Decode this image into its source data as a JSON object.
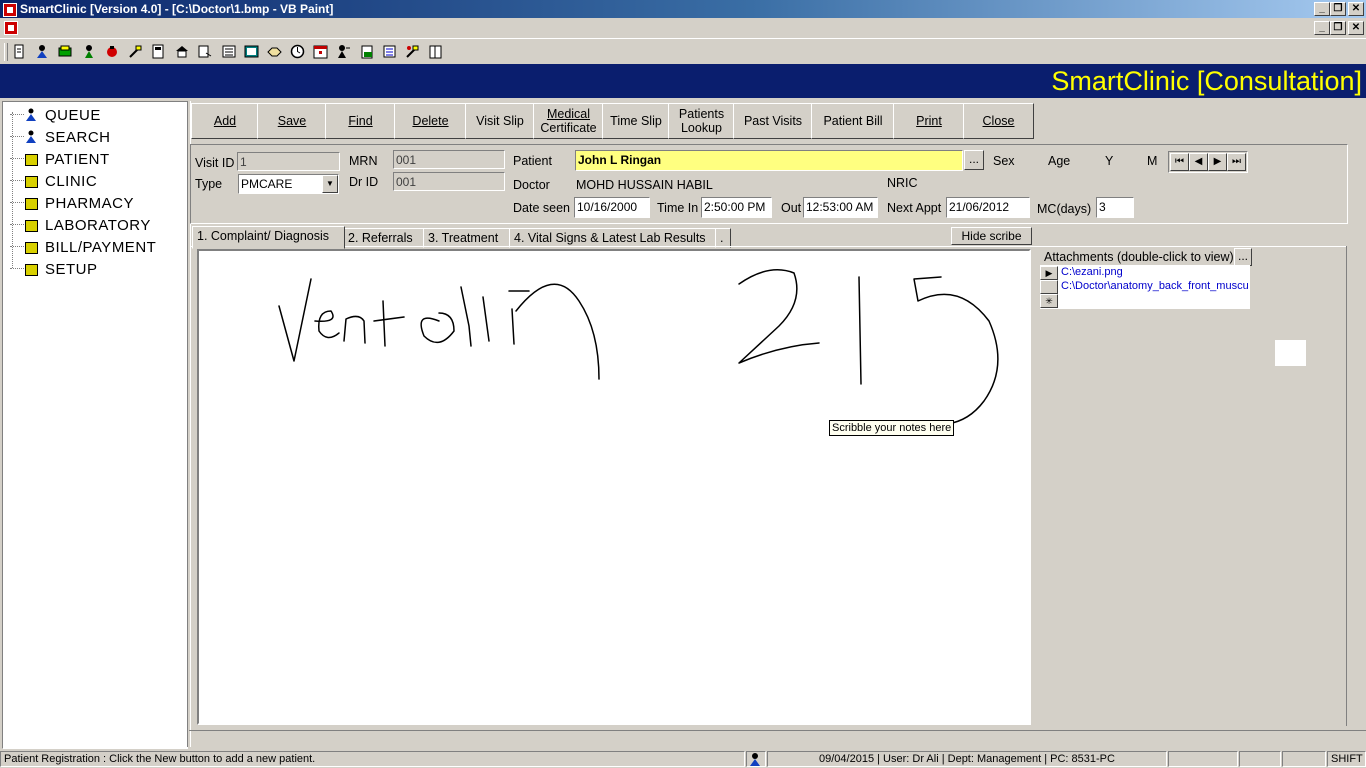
{
  "window": {
    "title": "SmartClinic [Version 4.0] - [C:\\Doctor\\1.bmp - VB Paint]"
  },
  "banner": {
    "title": "SmartClinic [Consultation]",
    "bg_color": "#0a1e6e",
    "text_color": "#ffff00"
  },
  "nav": {
    "items": [
      {
        "label": "QUEUE",
        "icon": "person-icon"
      },
      {
        "label": "SEARCH",
        "icon": "person-icon"
      },
      {
        "label": "PATIENT",
        "icon": "folder-icon"
      },
      {
        "label": "CLINIC",
        "icon": "folder-icon"
      },
      {
        "label": "PHARMACY",
        "icon": "folder-icon"
      },
      {
        "label": "LABORATORY",
        "icon": "folder-icon"
      },
      {
        "label": "BILL/PAYMENT",
        "icon": "folder-icon"
      },
      {
        "label": "SETUP",
        "icon": "folder-icon"
      }
    ]
  },
  "commands": {
    "add": "Add",
    "save": "Save",
    "find": "Find",
    "delete": "Delete",
    "visit_slip": "Visit Slip",
    "medical_certificate_1": "Medical",
    "medical_certificate_2": "Certificate",
    "time_slip": "Time Slip",
    "patients_lookup_1": "Patients",
    "patients_lookup_2": "Lookup",
    "past_visits": "Past Visits",
    "patient_bill": "Patient Bill",
    "print": "Print",
    "close": "Close"
  },
  "visit": {
    "visit_id_label": "Visit ID",
    "visit_id": "1",
    "type_label": "Type",
    "type": "PMCARE",
    "mrn_label": "MRN",
    "mrn": "001",
    "dr_id_label": "Dr ID",
    "dr_id": "001",
    "patient_label": "Patient",
    "patient": "John L Ringan",
    "patient_field_color": "#ffff80",
    "lookup_button": "...",
    "doctor_label": "Doctor",
    "doctor": "MOHD HUSSAIN HABIL",
    "sex_label": "Sex",
    "age_label": "Age",
    "age_unit": "Y",
    "months_unit": "M",
    "nric_label": "NRIC",
    "date_seen_label": "Date seen",
    "date_seen": "10/16/2000",
    "time_in_label": "Time In",
    "time_in": "2:50:00 PM",
    "out_label": "Out",
    "time_out": "12:53:00 AM",
    "next_appt_label": "Next Appt",
    "next_appt": "21/06/2012",
    "mc_label": "MC(days)",
    "mc_days": "3"
  },
  "tabs": [
    {
      "label": "1. Complaint/ Diagnosis"
    },
    {
      "label": "2. Referrals"
    },
    {
      "label": "3. Treatment"
    },
    {
      "label": "4. Vital Signs & Latest Lab Results"
    },
    {
      "label": "."
    }
  ],
  "scribe": {
    "hide_button": "Hide scribe",
    "tooltip": "Scribble your notes here"
  },
  "attachments": {
    "title": "Attachments (double-click to view)",
    "browse_button": "...",
    "files": [
      "C:\\ezani.png",
      "C:\\Doctor\\anatomy_back_front_muscu"
    ]
  },
  "status": {
    "message": "Patient Registration : Click the New button to add a new patient.",
    "info": "09/04/2015 | User: Dr Ali | Dept: Management | PC: 8531-PC",
    "shift": "SHIFT"
  }
}
